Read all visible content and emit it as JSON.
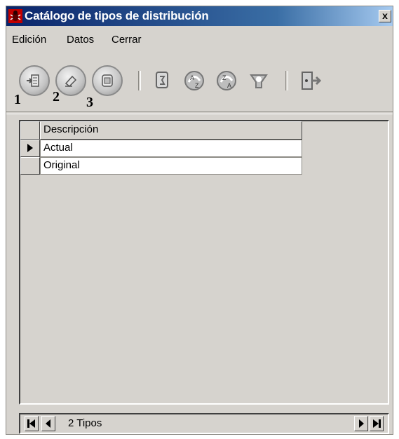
{
  "window": {
    "title": "Catálogo de tipos de distribución",
    "close_label": "x"
  },
  "menu": {
    "items": [
      "Edición",
      "Datos",
      "Cerrar"
    ]
  },
  "toolbar": {
    "callouts": [
      "1",
      "2",
      "3"
    ]
  },
  "grid": {
    "column_header": "Descripción",
    "rows": [
      "Actual",
      "Original"
    ],
    "selected_row": 0
  },
  "navigator": {
    "status": "2 Tipos"
  }
}
